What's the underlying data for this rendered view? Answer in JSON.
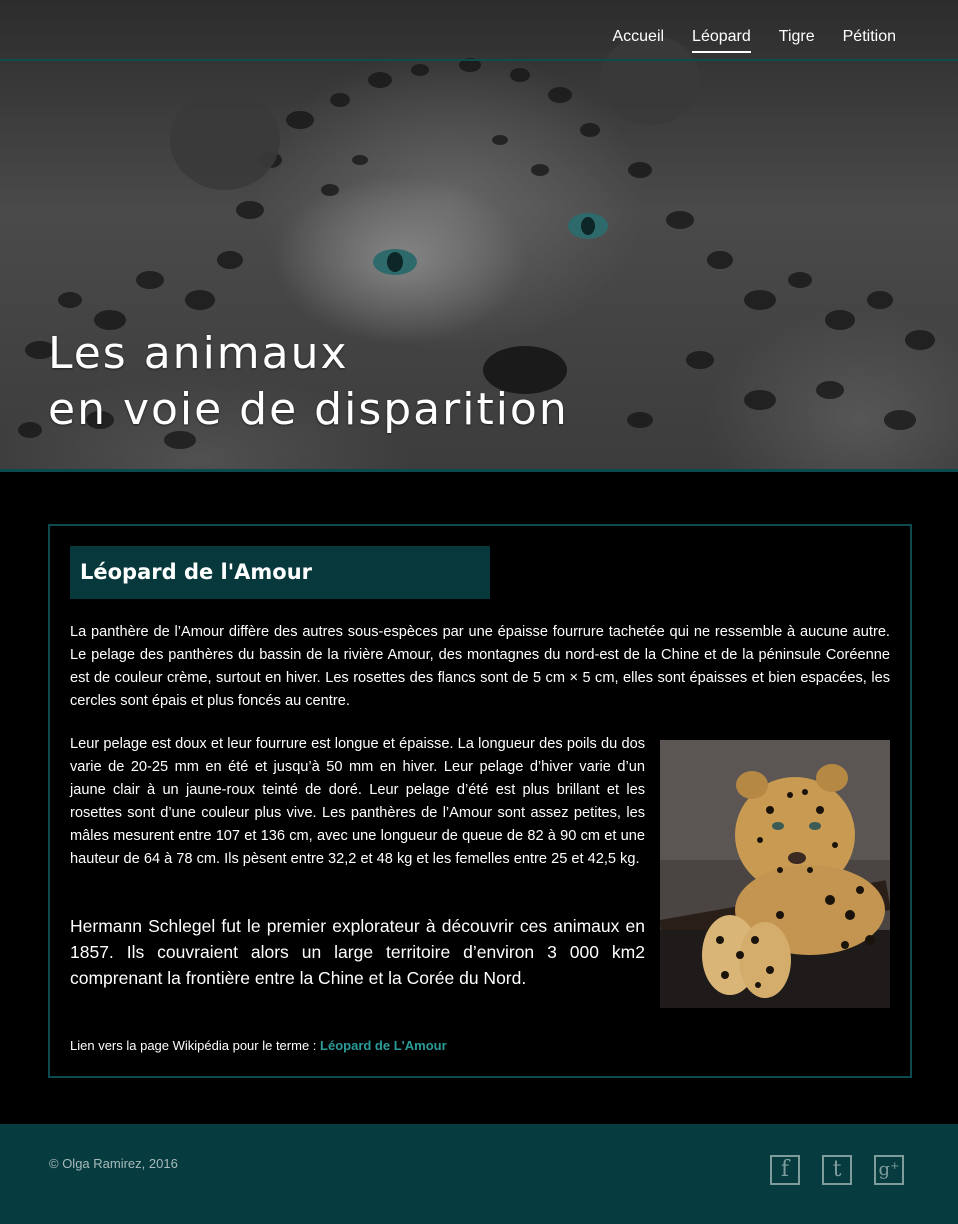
{
  "nav": {
    "items": [
      {
        "label": "Accueil",
        "active": false
      },
      {
        "label": "Léopard",
        "active": true
      },
      {
        "label": "Tigre",
        "active": false
      },
      {
        "label": "Pétition",
        "active": false
      }
    ]
  },
  "hero": {
    "title_line1": "Les animaux",
    "title_line2": "en voie de disparition"
  },
  "article": {
    "heading": "Léopard de l'Amour",
    "paragraph1": "La panthère de l’Amour diffère des autres sous-espèces par une épaisse fourrure tachetée qui ne ressemble à aucune autre. Le pelage des panthères du bassin de la rivière Amour, des montagnes du nord-est de la Chine et de la péninsule Coréenne est de couleur crème, surtout en hiver. Les rosettes des flancs sont de 5 cm × 5 cm, elles sont épaisses et bien espacées, les cercles sont épais et plus foncés au centre.",
    "paragraph2": "Leur pelage est doux et leur fourrure est longue et épaisse. La longueur des poils du dos varie de 20-25 mm en été et jusqu’à 50 mm en hiver. Leur pelage d’hiver varie d’un jaune clair à un jaune-roux teinté de doré. Leur pelage d’été est plus brillant et les rosettes sont d’une couleur plus vive. Les panthères de l’Amour sont assez petites, les mâles mesurent entre 107 et 136 cm, avec une longueur de queue de 82 à 90 cm et une hauteur de 64 à 78 cm. Ils pèsent entre 32,2 et 48 kg et les femelles entre 25 et 42,5 kg.",
    "paragraph3": "Hermann Schlegel fut le premier explorateur à découvrir ces animaux en 1857. Ils couvraient alors un large territoire d’environ 3 000 km2 comprenant la frontière entre la Chine et la Corée du Nord.",
    "wiki_prefix": "Lien vers la page Wikipédia pour le terme :",
    "wiki_link": "Léopard de L'Amour"
  },
  "footer": {
    "copyright": "© Olga Ramirez, 2016",
    "social": [
      {
        "icon": "facebook-icon",
        "glyph": "f"
      },
      {
        "icon": "tumblr-icon",
        "glyph": "t"
      },
      {
        "icon": "google-plus-icon",
        "glyph": "g⁺"
      }
    ]
  },
  "colors": {
    "accent_teal": "#07393c",
    "link_teal": "#2a9c9a",
    "footer_bg": "#063c40"
  }
}
